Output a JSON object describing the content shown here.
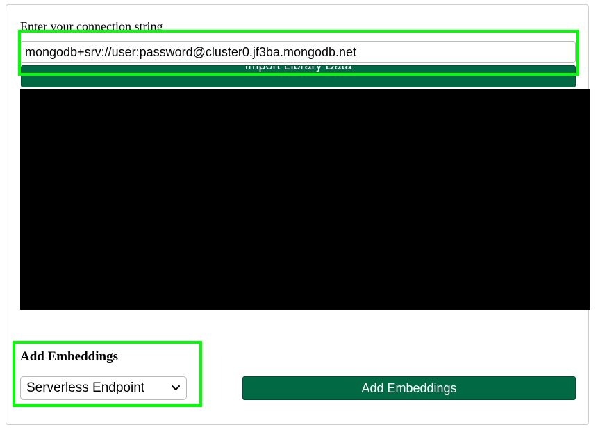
{
  "connection": {
    "label": "Enter your connection string",
    "value": "mongodb+srv://user:password@cluster0.jf3ba.mongodb.net"
  },
  "import": {
    "button_label": "Import Library Data"
  },
  "embeddings": {
    "title": "Add Embeddings",
    "selected_endpoint": "Serverless Endpoint",
    "button_label": "Add Embeddings"
  },
  "colors": {
    "button_green": "#016a45",
    "highlight_green": "#00ff00",
    "log_background": "#000000"
  },
  "icons": {
    "select_arrow": "chevron-down-icon"
  }
}
